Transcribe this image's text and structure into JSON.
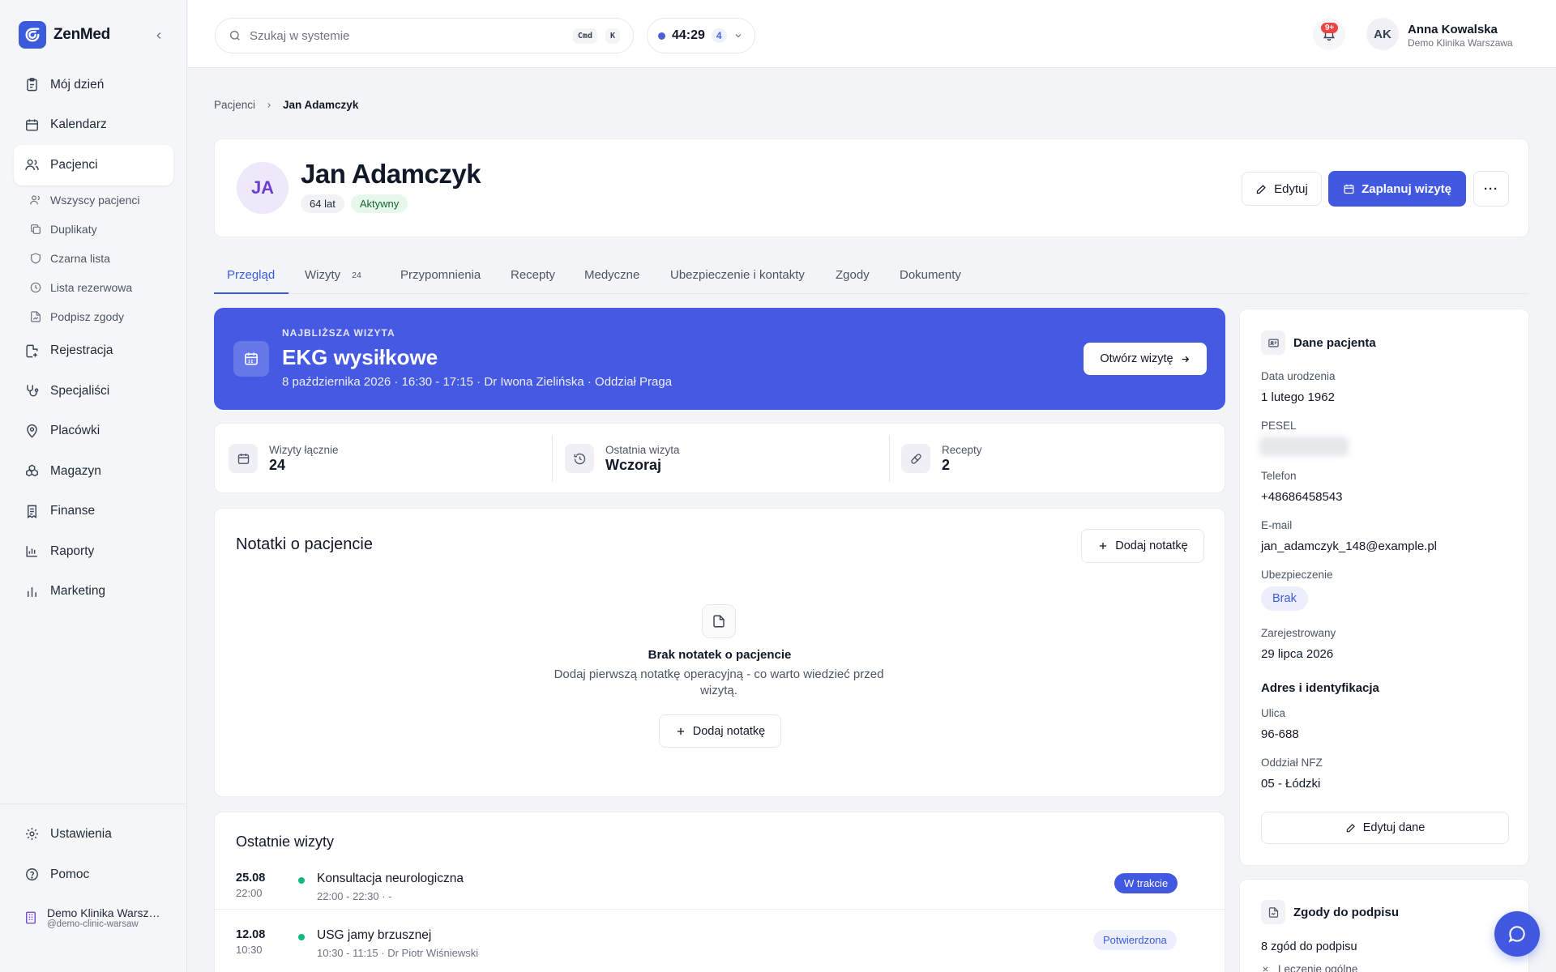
{
  "app": {
    "name": "ZenMed"
  },
  "sidebar": {
    "items": [
      {
        "label": "Mój dzień",
        "icon": "clipboard-icon"
      },
      {
        "label": "Kalendarz",
        "icon": "calendar-icon"
      },
      {
        "label": "Pacjenci",
        "icon": "users-icon",
        "active": true
      },
      {
        "label": "Rejestracja",
        "icon": "register-icon"
      },
      {
        "label": "Specjaliści",
        "icon": "stethoscope-icon"
      },
      {
        "label": "Placówki",
        "icon": "map-pin-icon"
      },
      {
        "label": "Magazyn",
        "icon": "boxes-icon"
      },
      {
        "label": "Finanse",
        "icon": "receipt-icon"
      },
      {
        "label": "Raporty",
        "icon": "bar-chart-icon"
      },
      {
        "label": "Marketing",
        "icon": "chart-icon"
      }
    ],
    "subitems": [
      {
        "label": "Wszyscy pacjenci"
      },
      {
        "label": "Duplikaty"
      },
      {
        "label": "Czarna lista"
      },
      {
        "label": "Lista rezerwowa"
      },
      {
        "label": "Podpisz zgody"
      }
    ],
    "bottom": {
      "settings": "Ustawienia",
      "help": "Pomoc"
    },
    "org": {
      "name": "Demo Klinika Warszawa",
      "handle": "@demo-clinic-warsaw"
    }
  },
  "topbar": {
    "search_placeholder": "Szukaj w systemie",
    "kbd_cmd": "Cmd",
    "kbd_k": "K",
    "timer": "44:29",
    "timer_count": "4",
    "notifications": "9+",
    "user": {
      "initials": "AK",
      "name": "Anna Kowalska",
      "org": "Demo Klinika Warszawa"
    }
  },
  "breadcrumb": {
    "parent": "Pacjenci",
    "current": "Jan Adamczyk"
  },
  "patient": {
    "initials": "JA",
    "name": "Jan Adamczyk",
    "age": "64 lat",
    "status": "Aktywny",
    "edit_label": "Edytuj",
    "schedule_label": "Zaplanuj wizytę",
    "more_label": "···"
  },
  "tabs": [
    {
      "label": "Przegląd",
      "active": true
    },
    {
      "label": "Wizyty",
      "count": "24"
    },
    {
      "label": "Przypomnienia"
    },
    {
      "label": "Recepty"
    },
    {
      "label": "Medyczne"
    },
    {
      "label": "Ubezpieczenie i kontakty"
    },
    {
      "label": "Zgody"
    },
    {
      "label": "Dokumenty"
    }
  ],
  "next_visit": {
    "label": "NAJBLIŻSZA WIZYTA",
    "title": "EKG wysiłkowe",
    "details": "8 października 2026 · 16:30 - 17:15 · Dr Iwona Zielińska · Oddział Praga",
    "open_label": "Otwórz wizytę"
  },
  "stats": [
    {
      "label": "Wizyty łącznie",
      "value": "24",
      "icon": "calendar-icon"
    },
    {
      "label": "Ostatnia wizyta",
      "value": "Wczoraj",
      "icon": "history-icon"
    },
    {
      "label": "Recepty",
      "value": "2",
      "icon": "pill-icon"
    }
  ],
  "notes": {
    "title": "Notatki o pacjencie",
    "add_label": "Dodaj notatkę",
    "empty_title": "Brak notatek o pacjencie",
    "empty_desc": "Dodaj pierwszą notatkę operacyjną - co warto wiedzieć przed wizytą.",
    "empty_add_label": "Dodaj notatkę"
  },
  "recent_visits": {
    "title": "Ostatnie wizyty",
    "items": [
      {
        "date": "25.08",
        "time": "22:00",
        "title": "Konsultacja neurologiczna",
        "details": "22:00 - 22:30 · -",
        "status": "W trakcie",
        "status_color": "#4059e0"
      },
      {
        "date": "12.08",
        "time": "10:30",
        "title": "USG jamy brzusznej",
        "details": "10:30 - 11:15 · Dr Piotr Wiśniewski",
        "status": "Potwierdzona",
        "status_color": "#eceefb"
      }
    ]
  },
  "patient_data": {
    "title": "Dane pacjenta",
    "dob_label": "Data urodzenia",
    "dob": "1 lutego 1962",
    "pesel_label": "PESEL",
    "phone_label": "Telefon",
    "phone": "+48686458543",
    "email_label": "E-mail",
    "email": "jan_adamczyk_148@example.pl",
    "insurance_label": "Ubezpieczenie",
    "insurance": "Brak",
    "registered_label": "Zarejestrowany",
    "registered": "29 lipca 2026",
    "address_title": "Adres i identyfikacja",
    "street_label": "Ulica",
    "street": "96-688",
    "nfz_label": "Oddział NFZ",
    "nfz": "05 - Łódzki",
    "edit_label": "Edytuj dane"
  },
  "consents": {
    "title": "Zgody do podpisu",
    "count_text": "8 zgód do podpisu",
    "first_item": "Leczenie ogólne"
  }
}
